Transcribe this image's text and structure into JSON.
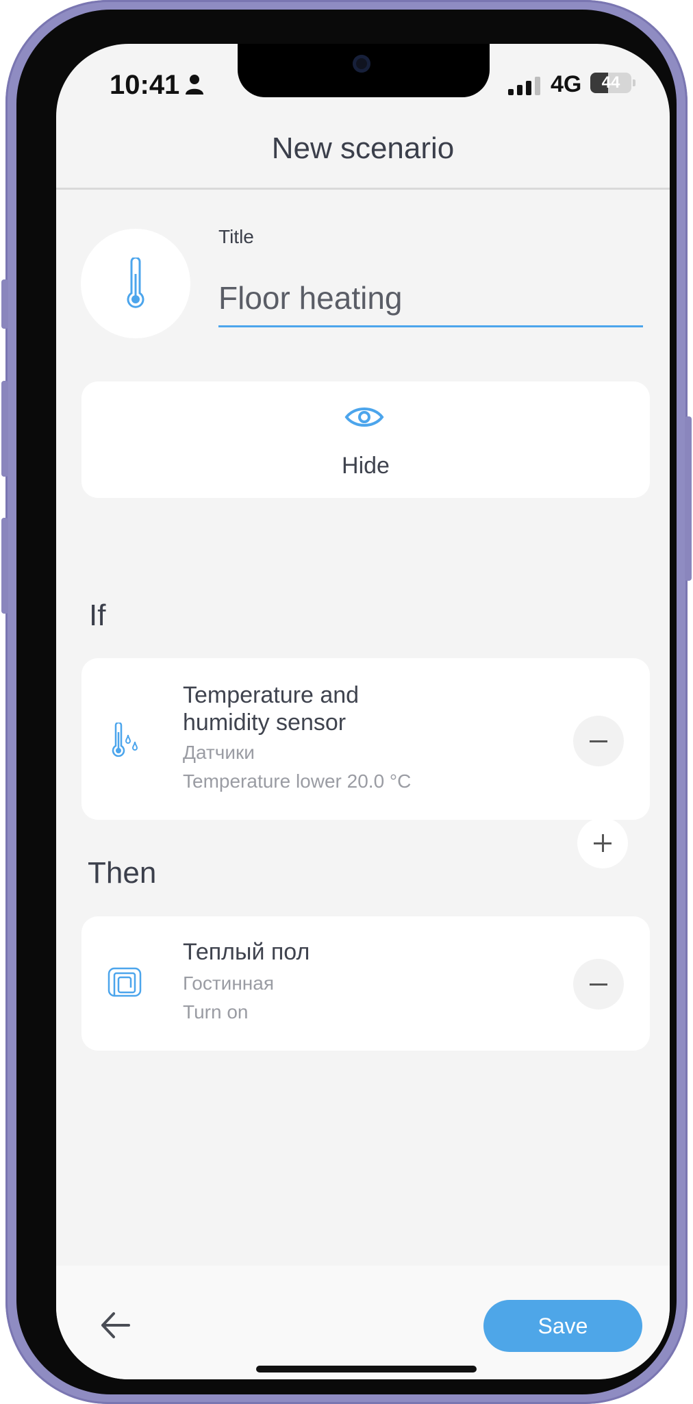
{
  "status_bar": {
    "time": "10:41",
    "network": "4G",
    "battery": "44",
    "battery_level": 0.44
  },
  "header": {
    "title": "New scenario"
  },
  "scenario": {
    "icon": "thermometer-icon",
    "title_label": "Title",
    "title_value": "Floor heating"
  },
  "visibility": {
    "icon": "eye-icon",
    "label": "Hide"
  },
  "if_section": {
    "label": "If",
    "conditions": [
      {
        "icon": "temperature-humidity-icon",
        "name_line1": "Temperature and",
        "name_line2": "humidity sensor",
        "group": "Датчики",
        "condition": "Temperature lower 20.0 °C"
      }
    ]
  },
  "then_section": {
    "label": "Then",
    "actions": [
      {
        "icon": "floor-heating-icon",
        "name": "Теплый пол",
        "room": "Гостинная",
        "action": "Turn on"
      }
    ]
  },
  "footer": {
    "back_icon": "arrow-left-icon",
    "save_label": "Save"
  },
  "colors": {
    "accent": "#4ea6e8",
    "background": "#f4f4f4",
    "card": "#ffffff"
  }
}
